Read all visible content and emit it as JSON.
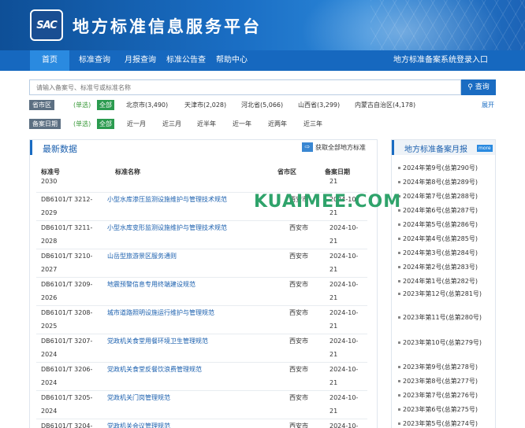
{
  "header": {
    "logo_text": "SAC",
    "title": "地方标准信息服务平台"
  },
  "nav": {
    "items": [
      "首页",
      "标准查询",
      "月报查询",
      "标准公告查",
      "帮助中心"
    ],
    "login": "地方标准备案系统登录入口"
  },
  "search": {
    "placeholder": "请输入备案号、标准号或标准名称",
    "button": "查询"
  },
  "filters": {
    "region": {
      "label": "省市区",
      "note": "(单选)",
      "all": "全部",
      "options": [
        "北京市(3,490)",
        "天津市(2,028)",
        "河北省(5,066)",
        "山西省(3,299)",
        "内蒙古自治区(4,178)"
      ],
      "expand": "展开"
    },
    "date": {
      "label": "备案日期",
      "note": "(单选)",
      "all": "全部",
      "options": [
        "近一月",
        "近三月",
        "近半年",
        "近一年",
        "近两年",
        "近三年"
      ]
    }
  },
  "latest": {
    "title": "最新数据",
    "link": "获取全部地方标准",
    "columns": [
      "标准号",
      "标准名称",
      "省市区",
      "备案日期"
    ],
    "partial_top": {
      "code": "2030",
      "date": "21"
    },
    "rows": [
      {
        "code_a": "DB6101/T 3212-",
        "code_b": "2029",
        "name": "小型水库渗压监测设施维护与管理技术规范",
        "area": "西安市",
        "date_a": "2024-10-",
        "date_b": "21"
      },
      {
        "code_a": "DB6101/T 3211-",
        "code_b": "2028",
        "name": "小型水库变形监测设施维护与管理技术规范",
        "area": "西安市",
        "date_a": "2024-10-",
        "date_b": "21"
      },
      {
        "code_a": "DB6101/T 3210-",
        "code_b": "2027",
        "name": "山岳型旅游景区服务通则",
        "area": "西安市",
        "date_a": "2024-10-",
        "date_b": "21"
      },
      {
        "code_a": "DB6101/T 3209-",
        "code_b": "2026",
        "name": "地震预警信息专用终端建设规范",
        "area": "西安市",
        "date_a": "2024-10-",
        "date_b": "21"
      },
      {
        "code_a": "DB6101/T 3208-",
        "code_b": "2025",
        "name": "城市道路照明设施运行维护与管理规范",
        "area": "西安市",
        "date_a": "2024-10-",
        "date_b": "21"
      },
      {
        "code_a": "DB6101/T 3207-",
        "code_b": "2024",
        "name": "党政机关食堂用餐环境卫生管理规范",
        "area": "西安市",
        "date_a": "2024-10-",
        "date_b": "21"
      },
      {
        "code_a": "DB6101/T 3206-",
        "code_b": "2024",
        "name": "党政机关食堂反餐饮浪费管理规范",
        "area": "西安市",
        "date_a": "2024-10-",
        "date_b": "21"
      },
      {
        "code_a": "DB6101/T 3205-",
        "code_b": "2024",
        "name": "党政机关门岗管理规范",
        "area": "西安市",
        "date_a": "2024-10-",
        "date_b": "21"
      },
      {
        "code_a": "DB6101/T 3204-",
        "code_b": "",
        "name": "党政机关会议管理规范",
        "area": "西安市",
        "date_a": "2024-10-",
        "date_b": ""
      }
    ]
  },
  "monthly": {
    "title": "地方标准备案月报",
    "more": "more",
    "items": [
      "2024年第9号(总第290号)",
      "2024年第8号(总第289号)",
      "2024年第7号(总第288号)",
      "2024年第6号(总第287号)",
      "2024年第5号(总第286号)",
      "2024年第4号(总第285号)",
      "2024年第3号(总第284号)",
      "2024年第2号(总第283号)",
      "2024年第1号(总第282号)",
      "2023年第12号(总第281号)",
      "2023年第11号(总第280号)",
      "2023年第10号(总第279号)",
      "2023年第9号(总第278号)",
      "2023年第8号(总第277号)",
      "2023年第7号(总第276号)",
      "2023年第6号(总第275号)",
      "2023年第5号(总第274号)"
    ]
  },
  "watermark": "KUAIMEE.COM",
  "colors": {
    "brand": "#1668bf",
    "accent_green": "#2b9b4f",
    "link": "#1a5fae"
  }
}
